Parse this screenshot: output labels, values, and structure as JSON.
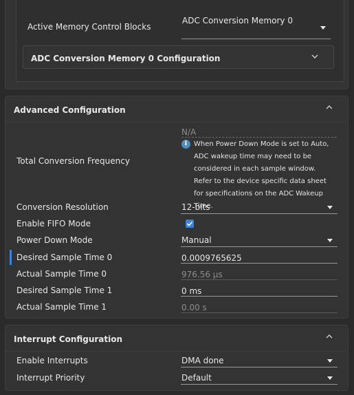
{
  "memory_section": {
    "active_blocks_label": "Active Memory Control Blocks",
    "active_blocks_value": "ADC Conversion Memory 0",
    "sub_card_title": "ADC Conversion Memory 0 Configuration"
  },
  "advanced": {
    "title": "Advanced Configuration",
    "total_conv_freq_label": "Total Conversion Frequency",
    "total_conv_freq_value": "N/A",
    "info_icon_glyph": "i",
    "note": "When Power Down Mode is set to Auto, ADC wakeup time may need to be considered in each sample window. Refer to the device specific data sheet for specifications on the ADC Wakeup Time.",
    "resolution_label": "Conversion Resolution",
    "resolution_value": "12-bits",
    "fifo_label": "Enable FIFO Mode",
    "fifo_checked": true,
    "power_down_label": "Power Down Mode",
    "power_down_value": "Manual",
    "desired_sample0_label": "Desired Sample Time 0",
    "desired_sample0_value": "0.0009765625",
    "actual_sample0_label": "Actual Sample Time 0",
    "actual_sample0_value": "976.56 µs",
    "desired_sample1_label": "Desired Sample Time 1",
    "desired_sample1_value": "0 ms",
    "actual_sample1_label": "Actual Sample Time 1",
    "actual_sample1_value": "0.00 s"
  },
  "interrupt": {
    "title": "Interrupt Configuration",
    "enable_label": "Enable Interrupts",
    "enable_value": "DMA done",
    "priority_label": "Interrupt Priority",
    "priority_value": "Default"
  },
  "colors": {
    "accent": "#3b82d9",
    "background": "#2a2a2a",
    "panel": "#333333"
  }
}
